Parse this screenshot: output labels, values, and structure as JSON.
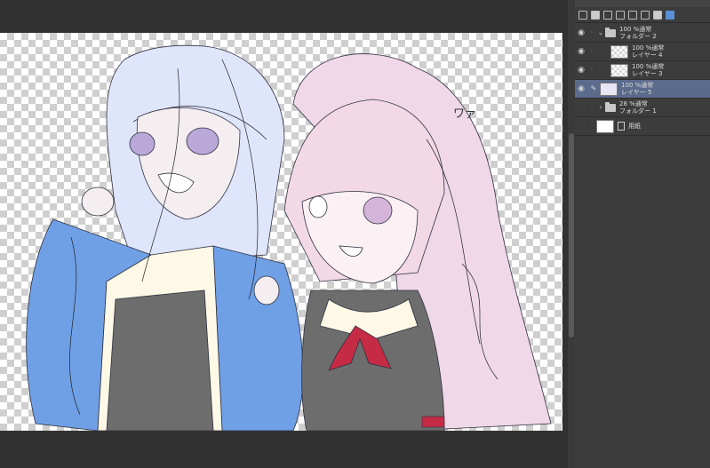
{
  "layers": [
    {
      "id": "folder2",
      "type": "folder",
      "opacity_blend": "100 %通常",
      "name": "フォルダー 2",
      "expanded": true,
      "indent": 0
    },
    {
      "id": "layer4",
      "type": "raster",
      "opacity_blend": "100 %通常",
      "name": "レイヤー 4",
      "indent": 1
    },
    {
      "id": "layer3",
      "type": "raster",
      "opacity_blend": "100 %通常",
      "name": "レイヤー 3",
      "indent": 1
    },
    {
      "id": "layer5",
      "type": "raster",
      "opacity_blend": "100 %通常",
      "name": "レイヤー 5",
      "indent": 0,
      "selected": true
    },
    {
      "id": "folder1",
      "type": "folder",
      "opacity_blend": "28 %通常",
      "name": "フォルダー 1",
      "expanded": false,
      "indent": 0
    },
    {
      "id": "paper",
      "type": "paper",
      "opacity_blend": "",
      "name": "用紙",
      "indent": 0
    }
  ],
  "colors": {
    "selected_layer": "#5b6b8c",
    "panel_bg": "#3c3c3c",
    "canvas_surround": "#323232"
  },
  "canvas_scribble_text": "ワァ"
}
